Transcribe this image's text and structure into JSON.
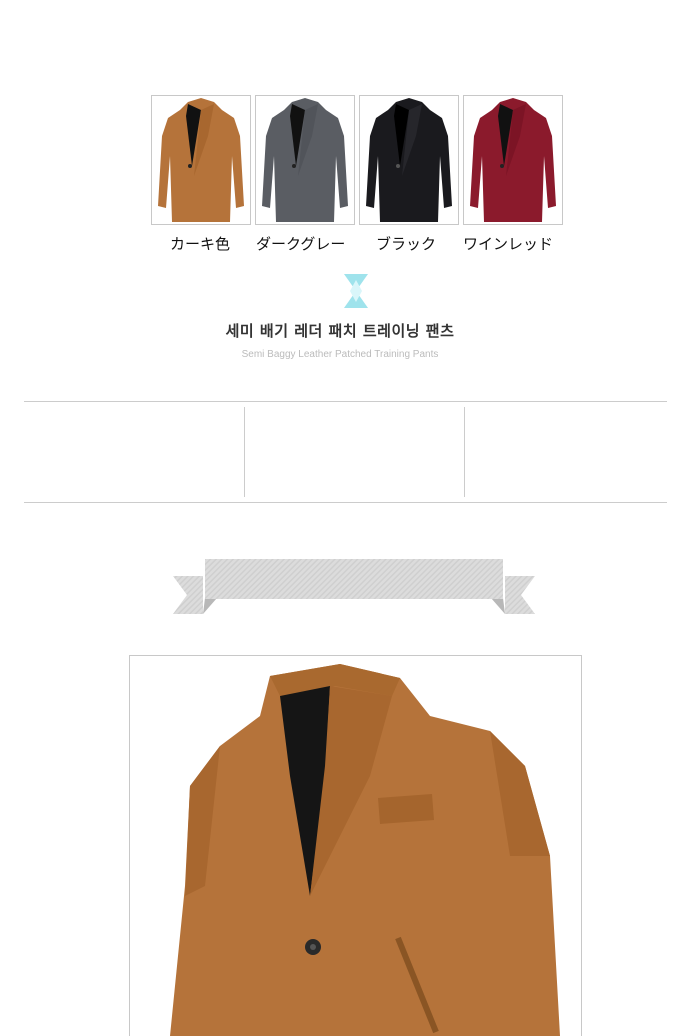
{
  "colors": [
    {
      "label": "カーキ色",
      "hex": "#b5733a"
    },
    {
      "label": "ダークグレー",
      "hex": "#5a5d63"
    },
    {
      "label": "ブラック",
      "hex": "#1a1a1e"
    },
    {
      "label": "ワインレッド",
      "hex": "#8b1a2c"
    }
  ],
  "section": {
    "title_ko": "세미 배기 레더 패치 트레이닝 팬츠",
    "title_en": "Semi Baggy Leather Patched Training Pants"
  },
  "icons": {
    "divider": "diamond-divider-icon",
    "ribbon": "ribbon-banner"
  }
}
